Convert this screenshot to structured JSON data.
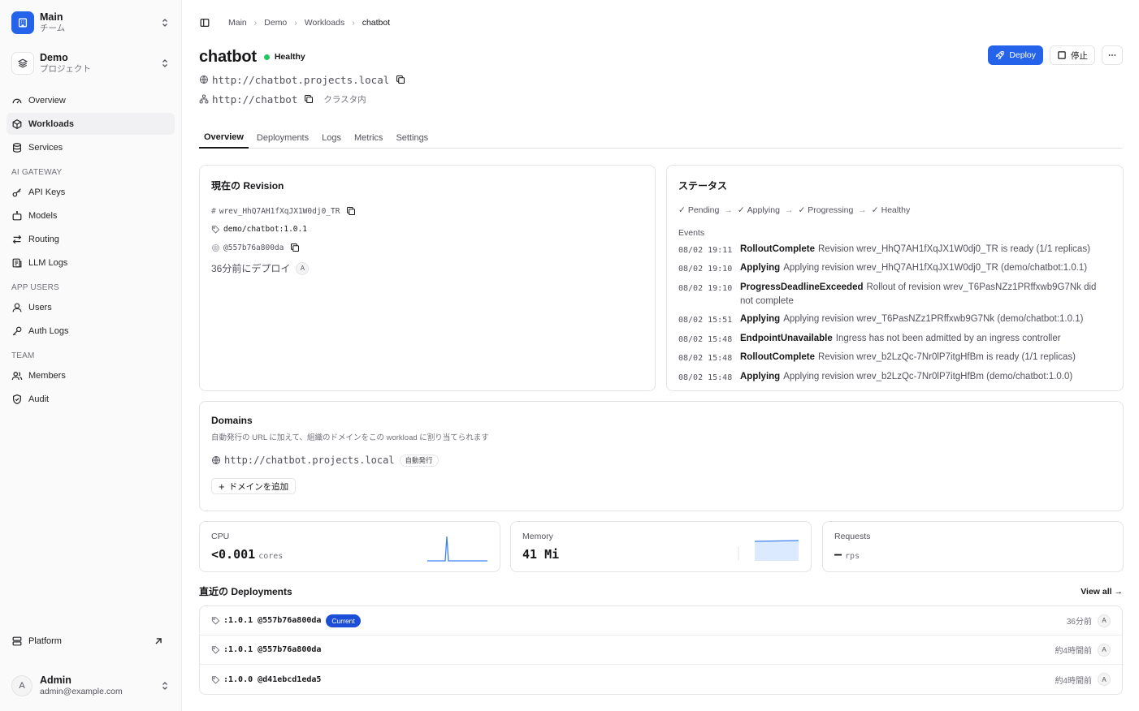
{
  "sidebar": {
    "team": {
      "name": "Main",
      "sub": "チーム"
    },
    "project": {
      "name": "Demo",
      "sub": "プロジェクト"
    },
    "nav": {
      "overview": "Overview",
      "workloads": "Workloads",
      "services": "Services"
    },
    "ai_gateway": {
      "label": "AI GATEWAY",
      "api_keys": "API Keys",
      "models": "Models",
      "routing": "Routing",
      "llm_logs": "LLM Logs"
    },
    "app_users": {
      "label": "APP USERS",
      "users": "Users",
      "auth_logs": "Auth Logs"
    },
    "team_section": {
      "label": "TEAM",
      "members": "Members",
      "audit": "Audit"
    },
    "platform": "Platform",
    "user": {
      "initial": "A",
      "name": "Admin",
      "email": "admin@example.com"
    }
  },
  "breadcrumb": [
    "Main",
    "Demo",
    "Workloads",
    "chatbot"
  ],
  "header": {
    "title": "chatbot",
    "status": "Healthy",
    "status_color": "#22c55e",
    "public_url": "http://chatbot.projects.local",
    "internal_url": "http://chatbot",
    "internal_note": "クラスタ内",
    "deploy_label": "Deploy",
    "stop_label": "停止"
  },
  "tabs": [
    "Overview",
    "Deployments",
    "Logs",
    "Metrics",
    "Settings"
  ],
  "revision": {
    "title": "現在の Revision",
    "id": "wrev_HhQ7AH1fXqJX1W0dj0_TR",
    "image": "demo/chatbot:1.0.1",
    "digest": "@557b76a800da",
    "deployed": "36分前にデプロイ",
    "avatar": "A"
  },
  "status": {
    "title": "ステータス",
    "steps": [
      "Pending",
      "Applying",
      "Progressing",
      "Healthy"
    ],
    "events_label": "Events",
    "events": [
      {
        "time": "08/02 19:11",
        "reason": "RolloutComplete",
        "message": "Revision wrev_HhQ7AH1fXqJX1W0dj0_TR is ready (1/1 replicas)"
      },
      {
        "time": "08/02 19:10",
        "reason": "Applying",
        "message": "Applying revision wrev_HhQ7AH1fXqJX1W0dj0_TR (demo/chatbot:1.0.1)"
      },
      {
        "time": "08/02 19:10",
        "reason": "ProgressDeadlineExceeded",
        "message": "Rollout of revision wrev_T6PasNZz1PRffxwb9G7Nk did not complete"
      },
      {
        "time": "08/02 15:51",
        "reason": "Applying",
        "message": "Applying revision wrev_T6PasNZz1PRffxwb9G7Nk (demo/chatbot:1.0.1)"
      },
      {
        "time": "08/02 15:48",
        "reason": "EndpointUnavailable",
        "message": "Ingress has not been admitted by an ingress controller"
      },
      {
        "time": "08/02 15:48",
        "reason": "RolloutComplete",
        "message": "Revision wrev_b2LzQc-7Nr0lP7itgHfBm is ready (1/1 replicas)"
      },
      {
        "time": "08/02 15:48",
        "reason": "Applying",
        "message": "Applying revision wrev_b2LzQc-7Nr0lP7itgHfBm (demo/chatbot:1.0.0)"
      }
    ]
  },
  "domains": {
    "title": "Domains",
    "desc": "自動発行の URL に加えて、組織のドメインをこの workload に割り当てられます",
    "url": "http://chatbot.projects.local",
    "badge": "自動発行",
    "add_label": "ドメインを追加"
  },
  "metrics": {
    "cpu": {
      "label": "CPU",
      "value": "<0.001",
      "unit": "cores"
    },
    "memory": {
      "label": "Memory",
      "value": "41 Mi"
    },
    "requests": {
      "label": "Requests",
      "value": "—",
      "unit": "rps"
    }
  },
  "deployments": {
    "title": "直近の Deployments",
    "view_all": "View all",
    "items": [
      {
        "tag": ":1.0.1 @557b76a800da",
        "badge": "Current",
        "ago": "36分前",
        "avatar": "A"
      },
      {
        "tag": ":1.0.1 @557b76a800da",
        "ago": "約4時間前",
        "avatar": "A"
      },
      {
        "tag": ":1.0.0 @d41ebcd1eda5",
        "ago": "約4時間前",
        "avatar": "A"
      }
    ]
  }
}
